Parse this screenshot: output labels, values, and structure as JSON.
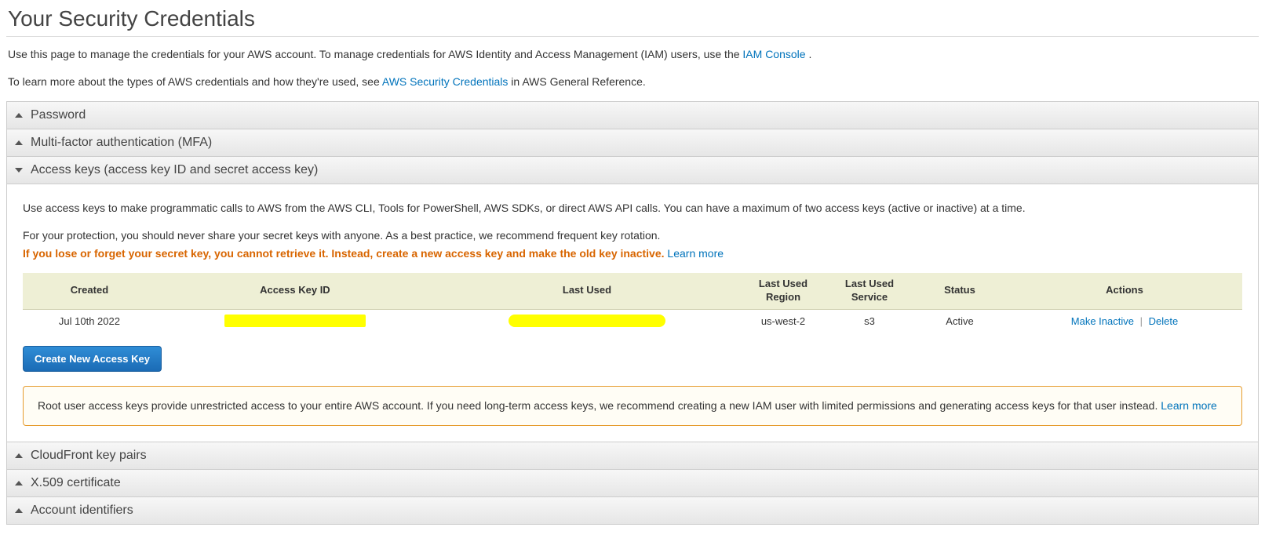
{
  "title": "Your Security Credentials",
  "intro": {
    "line1_pre": "Use this page to manage the credentials for your AWS account. To manage credentials for AWS Identity and Access Management (IAM) users, use the ",
    "line1_link": "IAM Console",
    "line1_post": " .",
    "line2_pre": "To learn more about the types of AWS credentials and how they're used, see ",
    "line2_link": "AWS Security Credentials",
    "line2_post": " in AWS General Reference."
  },
  "sections": {
    "password": "Password",
    "mfa": "Multi-factor authentication (MFA)",
    "access_keys": "Access keys (access key ID and secret access key)",
    "cloudfront": "CloudFront key pairs",
    "x509": "X.509 certificate",
    "account_ids": "Account identifiers"
  },
  "access_keys_body": {
    "p1": "Use access keys to make programmatic calls to AWS from the AWS CLI, Tools for PowerShell, AWS SDKs, or direct AWS API calls. You can have a maximum of two access keys (active or inactive) at a time.",
    "p2": "For your protection, you should never share your secret keys with anyone. As a best practice, we recommend frequent key rotation.",
    "warning": "If you lose or forget your secret key, you cannot retrieve it. Instead, create a new access key and make the old key inactive.",
    "learn_more": "Learn more",
    "table": {
      "headers": {
        "created": "Created",
        "key_id": "Access Key ID",
        "last_used": "Last Used",
        "last_used_region": "Last Used Region",
        "last_used_service": "Last Used Service",
        "status": "Status",
        "actions": "Actions"
      },
      "rows": [
        {
          "created": "Jul 10th 2022",
          "key_id": "",
          "last_used": "",
          "last_used_region": "us-west-2",
          "last_used_service": "s3",
          "status": "Active",
          "action_inactive": "Make Inactive",
          "action_delete": "Delete"
        }
      ]
    },
    "create_btn": "Create New Access Key",
    "info_box_text": "Root user access keys provide unrestricted access to your entire AWS account. If you need long-term access keys, we recommend creating a new IAM user with limited permissions and generating access keys for that user instead.  ",
    "info_box_link": "Learn more"
  }
}
